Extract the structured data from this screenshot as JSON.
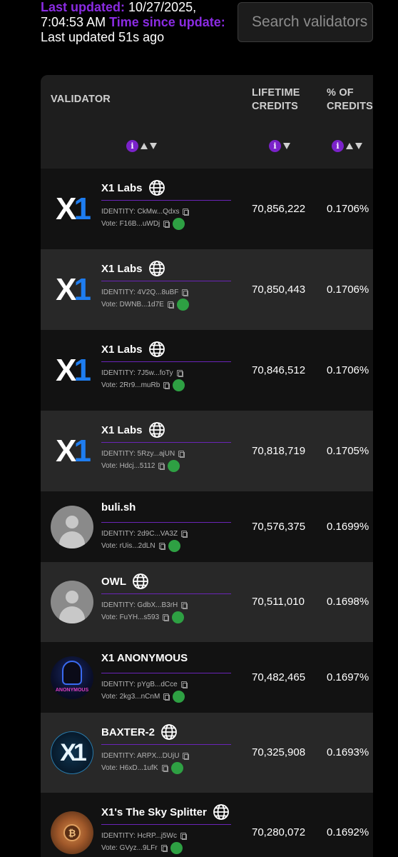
{
  "header": {
    "last_updated_label": "Last updated:",
    "last_updated_value": "10/27/2025, 7:04:53 AM",
    "time_since_label": "Time since update:",
    "time_since_value": "Last updated 51s ago",
    "search_placeholder": "Search validators"
  },
  "table": {
    "columns": {
      "validator": "VALIDATOR",
      "lifetime_credits": "LIFETIME CREDITS",
      "pct_credits": "% OF CREDITS"
    },
    "info_glyph": "i",
    "rows": [
      {
        "name": "X1 Labs",
        "logo": "x1",
        "has_globe": true,
        "identity": "IDENTITY: CkMw...Qdxs",
        "vote": "Vote: F16B...uWDj",
        "credits": "70,856,222",
        "pct": "0.1706%"
      },
      {
        "name": "X1 Labs",
        "logo": "x1",
        "has_globe": true,
        "identity": "IDENTITY: 4V2Q...8uBF",
        "vote": "Vote: DWNB...1d7E",
        "credits": "70,850,443",
        "pct": "0.1706%"
      },
      {
        "name": "X1 Labs",
        "logo": "x1",
        "has_globe": true,
        "identity": "IDENTITY: 7J5w...foTy",
        "vote": "Vote: 2Rr9...muRb",
        "credits": "70,846,512",
        "pct": "0.1706%"
      },
      {
        "name": "X1 Labs",
        "logo": "x1",
        "has_globe": true,
        "identity": "IDENTITY: 5Rzy...ajUN",
        "vote": "Vote: Hdcj...5112",
        "credits": "70,818,719",
        "pct": "0.1705%"
      },
      {
        "name": "buli.sh",
        "logo": "avatar",
        "has_globe": false,
        "identity": "IDENTITY: 2d9C...VA3Z",
        "vote": "Vote: rUis...2dLN",
        "credits": "70,576,375",
        "pct": "0.1699%"
      },
      {
        "name": "OWL",
        "logo": "avatar",
        "has_globe": true,
        "identity": "IDENTITY: GdbX...B3rH",
        "vote": "Vote: FuYH...s593",
        "credits": "70,511,010",
        "pct": "0.1698%"
      },
      {
        "name": "X1 ANONYMOUS",
        "logo": "anonymous",
        "logo_text": "ANONYMOUS",
        "has_globe": false,
        "identity": "IDENTITY: pYgB...dCce",
        "vote": "Vote: 2kg3...nCnM",
        "credits": "70,482,465",
        "pct": "0.1697%"
      },
      {
        "name": "BAXTER-2",
        "logo": "baxter",
        "has_globe": true,
        "identity": "IDENTITY: ARPX...DUjU",
        "vote": "Vote: H6xD...1ufK",
        "credits": "70,325,908",
        "pct": "0.1693%"
      },
      {
        "name": "X1's The Sky Splitter",
        "logo": "sky",
        "has_globe": true,
        "identity": "IDENTITY: HcRP...j5Wc",
        "vote": "Vote: GVyz...9LFr",
        "credits": "70,280,072",
        "pct": "0.1692%"
      }
    ]
  },
  "colors": {
    "accent_purple": "#8a2be2",
    "status_green": "#2ea043",
    "x1_blue": "#1e7df0"
  }
}
